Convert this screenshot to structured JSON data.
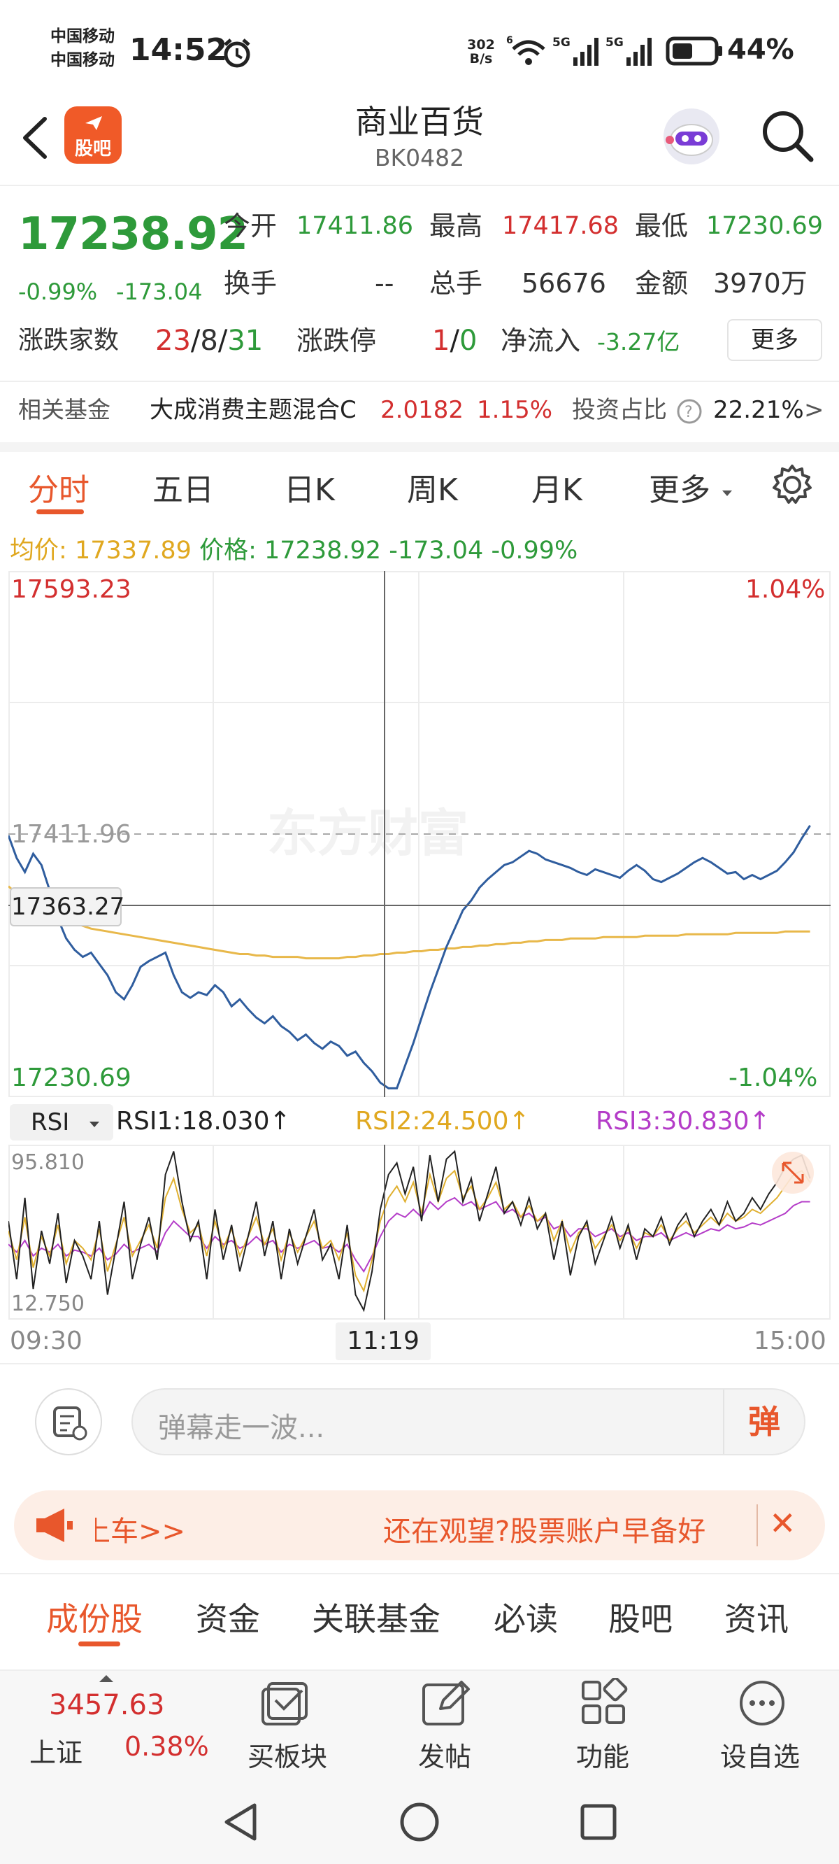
{
  "status_bar": {
    "carrier_1": "中国移动",
    "carrier_2": "中国移动",
    "time": "14:52",
    "net_speed_value": "302",
    "net_speed_unit": "B/s",
    "battery": "44%"
  },
  "header": {
    "title": "商业百货",
    "code": "BK0482",
    "logo_label": "股吧"
  },
  "quote": {
    "price": "17238.92",
    "change_pct": "-0.99%",
    "change": "-173.04",
    "open_label": "今开",
    "open": "17411.86",
    "high_label": "最高",
    "high": "17417.68",
    "low_label": "最低",
    "low": "17230.69",
    "turnover_label": "换手",
    "turnover": "--",
    "volume_label": "总手",
    "volume": "56676",
    "amount_label": "金额",
    "amount": "3970万",
    "adv_dec_label": "涨跌家数",
    "adv": "23",
    "flat": "8",
    "dec": "31",
    "limit_label": "涨跌停",
    "limit_up": "1",
    "limit_down": "0",
    "netflow_label": "净流入",
    "netflow": "-3.27亿",
    "more_button": "更多"
  },
  "fund": {
    "label": "相关基金",
    "name": "大成消费主题混合C",
    "nav": "2.0182",
    "pct": "1.15%",
    "ratio_label": "投资占比",
    "ratio": "22.21%",
    "arrow": ">"
  },
  "chart_tabs": [
    "分时",
    "五日",
    "日K",
    "周K",
    "月K",
    "更多"
  ],
  "avg_line": {
    "avg_label": "均价:",
    "avg": "17337.89",
    "price_label": "价格:",
    "price": "17238.92",
    "change": "-173.04",
    "pct": "-0.99%"
  },
  "colors": {
    "price_line": "#2f5d9e",
    "avg_line": "#e8b84a",
    "up": "#d32f2f",
    "down": "#2e9a3a",
    "accent": "#e8572c",
    "rsi1": "#222222",
    "rsi2": "#e0b030",
    "rsi3": "#b43cc8"
  },
  "chart_data": [
    {
      "type": "line",
      "y_max_label": "17593.23",
      "y_min_label": "17230.69",
      "pct_max_label": "1.04%",
      "pct_min_label": "-1.04%",
      "prev_close_label": "17411.96",
      "crosshair_value": "17363.27",
      "crosshair_time": "11:19",
      "ylim": [
        17230.69,
        17593.23
      ],
      "x_labels": [
        "09:30",
        "11:19",
        "15:00"
      ],
      "series": [
        {
          "values": [
            17411,
            17395,
            17385,
            17398,
            17390,
            17372,
            17352,
            17338,
            17330,
            17325,
            17328,
            17320,
            17312,
            17300,
            17295,
            17305,
            17318,
            17322,
            17325,
            17328,
            17312,
            17300,
            17296,
            17300,
            17298,
            17305,
            17300,
            17290,
            17295,
            17288,
            17282,
            17278,
            17283,
            17276,
            17272,
            17266,
            17270,
            17264,
            17260,
            17265,
            17262,
            17255,
            17258,
            17250,
            17244,
            17236,
            17232,
            17232,
            17248,
            17264,
            17282,
            17300,
            17316,
            17332,
            17345,
            17358,
            17365,
            17374,
            17380,
            17385,
            17390,
            17392,
            17396,
            17400,
            17398,
            17394,
            17392,
            17390,
            17388,
            17385,
            17383,
            17387,
            17385,
            17383,
            17381,
            17386,
            17390,
            17386,
            17380,
            17378,
            17381,
            17384,
            17388,
            17392,
            17395,
            17392,
            17388,
            17384,
            17385,
            17380,
            17383,
            17380,
            17383,
            17386,
            17392,
            17399,
            17409,
            17418
          ],
          "role": "price"
        },
        {
          "values": [
            17375,
            17370,
            17366,
            17362,
            17358,
            17355,
            17353,
            17351,
            17349,
            17347,
            17345,
            17344,
            17343,
            17342,
            17341,
            17340,
            17339,
            17338,
            17337,
            17336,
            17335,
            17334,
            17333,
            17332,
            17331,
            17330,
            17329,
            17328,
            17327,
            17327,
            17326,
            17326,
            17325,
            17325,
            17325,
            17325,
            17324,
            17324,
            17324,
            17324,
            17324,
            17325,
            17325,
            17326,
            17326,
            17327,
            17327,
            17328,
            17328,
            17329,
            17329,
            17330,
            17330,
            17331,
            17331,
            17332,
            17332,
            17333,
            17333,
            17334,
            17334,
            17335,
            17335,
            17336,
            17336,
            17337,
            17337,
            17337,
            17338,
            17338,
            17338,
            17338,
            17339,
            17339,
            17339,
            17339,
            17339,
            17340,
            17340,
            17340,
            17340,
            17340,
            17341,
            17341,
            17341,
            17341,
            17341,
            17341,
            17342,
            17342,
            17342,
            17342,
            17342,
            17342,
            17343,
            17343,
            17343,
            17343
          ],
          "role": "average"
        }
      ]
    },
    {
      "type": "line",
      "y_max_label": "95.810",
      "y_min_label": "12.750",
      "ylim": [
        12.75,
        95.81
      ],
      "series": [
        {
          "name": "RSI1",
          "last": "18.030",
          "values": [
            60,
            30,
            72,
            25,
            55,
            38,
            64,
            28,
            50,
            42,
            30,
            60,
            22,
            46,
            70,
            30,
            48,
            62,
            40,
            84,
            96,
            70,
            50,
            60,
            30,
            66,
            40,
            58,
            34,
            52,
            70,
            42,
            60,
            30,
            56,
            38,
            52,
            66,
            40,
            48,
            30,
            58,
            22,
            14,
            34,
            66,
            84,
            90,
            74,
            88,
            60,
            94,
            70,
            92,
            96,
            70,
            82,
            60,
            74,
            88,
            64,
            70,
            58,
            72,
            56,
            64,
            40,
            60,
            32,
            52,
            60,
            38,
            50,
            62,
            46,
            58,
            40,
            56,
            52,
            62,
            48,
            58,
            64,
            52,
            60,
            66,
            58,
            70,
            60,
            64,
            72,
            66,
            74,
            80,
            88,
            92,
            94,
            82
          ]
        },
        {
          "name": "RSI2",
          "last": "24.500",
          "values": [
            55,
            40,
            62,
            36,
            52,
            42,
            58,
            38,
            50,
            46,
            40,
            56,
            34,
            48,
            62,
            42,
            50,
            58,
            46,
            72,
            82,
            66,
            54,
            58,
            42,
            60,
            46,
            56,
            42,
            52,
            62,
            48,
            56,
            40,
            54,
            44,
            52,
            60,
            46,
            50,
            40,
            54,
            32,
            24,
            40,
            60,
            72,
            78,
            70,
            80,
            64,
            84,
            70,
            82,
            86,
            72,
            78,
            66,
            72,
            80,
            66,
            70,
            62,
            68,
            60,
            64,
            50,
            60,
            44,
            54,
            58,
            46,
            52,
            58,
            50,
            56,
            46,
            54,
            52,
            58,
            50,
            56,
            60,
            54,
            58,
            62,
            58,
            64,
            60,
            62,
            66,
            64,
            68,
            72,
            78,
            84,
            86,
            80
          ]
        },
        {
          "name": "RSI3",
          "last": "30.830",
          "values": [
            48,
            44,
            50,
            42,
            46,
            44,
            48,
            42,
            45,
            44,
            42,
            46,
            40,
            43,
            48,
            44,
            46,
            48,
            44,
            54,
            60,
            56,
            52,
            52,
            46,
            52,
            48,
            50,
            46,
            48,
            52,
            48,
            50,
            44,
            48,
            46,
            48,
            50,
            46,
            47,
            44,
            48,
            40,
            34,
            42,
            52,
            60,
            64,
            62,
            66,
            62,
            70,
            66,
            70,
            72,
            68,
            70,
            66,
            68,
            70,
            64,
            66,
            62,
            64,
            60,
            62,
            56,
            58,
            52,
            56,
            56,
            52,
            54,
            56,
            52,
            54,
            50,
            52,
            52,
            54,
            50,
            52,
            54,
            52,
            54,
            56,
            55,
            58,
            56,
            57,
            59,
            58,
            60,
            62,
            64,
            68,
            70,
            70
          ]
        }
      ]
    }
  ],
  "rsi_header": {
    "select_label": "RSI",
    "rsi1": "RSI1:18.030",
    "rsi2": "RSI2:24.500",
    "rsi3": "RSI3:30.830",
    "arrow": "↑"
  },
  "time_axis": {
    "start": "09:30",
    "mid": "11:19",
    "end": "15:00"
  },
  "danmu": {
    "placeholder": "弹幕走一波...",
    "button": "弹"
  },
  "banner": {
    "left_text": "上车>>",
    "right_text": "还在观望?股票账户早备好",
    "close": "✕"
  },
  "bottom_tabs": [
    "成份股",
    "资金",
    "关联基金",
    "必读",
    "股吧",
    "资讯"
  ],
  "bottom_nav": {
    "index_value": "3457.63",
    "index_name": "上证",
    "index_pct": "0.38%",
    "items": [
      "买板块",
      "发帖",
      "功能",
      "设自选"
    ]
  },
  "watermark": "东方财富"
}
